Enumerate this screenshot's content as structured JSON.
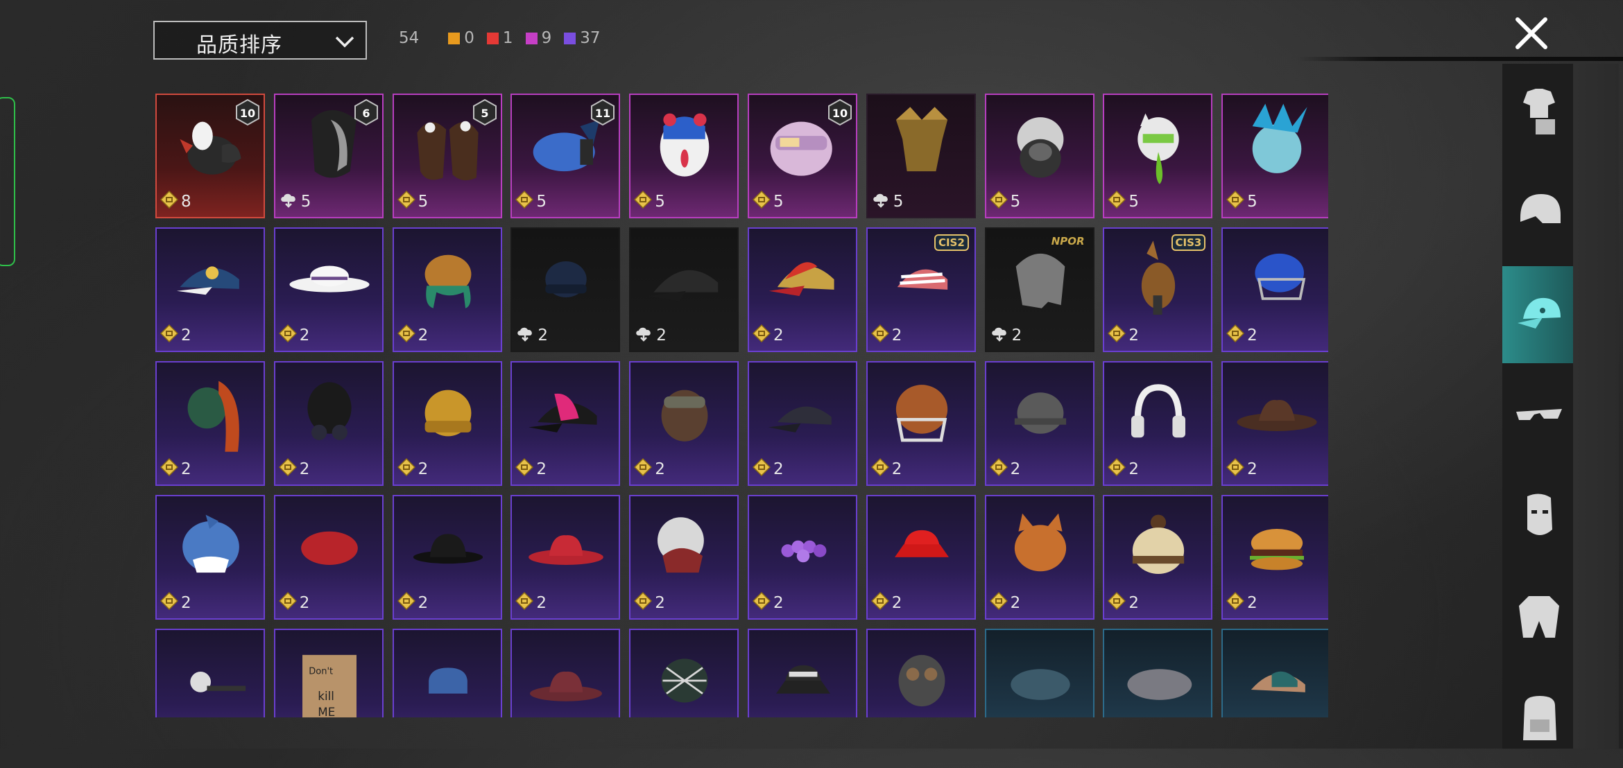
{
  "header": {
    "sort_label": "品质排序",
    "total_count": "54",
    "rarity_counts": [
      {
        "value": "0",
        "color": "#e89a1e"
      },
      {
        "value": "1",
        "color": "#e53935"
      },
      {
        "value": "9",
        "color": "#c63fc6"
      },
      {
        "value": "37",
        "color": "#7a4ee0"
      }
    ]
  },
  "icons": {
    "close": "close-icon",
    "sort": "chevron-down-icon",
    "currency": "gold-coin-icon",
    "cloud": "cloud-download-icon"
  },
  "items": [
    {
      "name": "rooster-chef-helmet",
      "cost": "8",
      "rarity": "mythic",
      "level": "10",
      "art": "rooster",
      "currency": "coin"
    },
    {
      "name": "masked-hood",
      "cost": "5",
      "rarity": "legend",
      "level": "6",
      "art": "mask",
      "currency": "cloud"
    },
    {
      "name": "bunny-hair",
      "cost": "5",
      "rarity": "legend",
      "level": "5",
      "art": "hair",
      "currency": "coin"
    },
    {
      "name": "blue-tech-cap",
      "cost": "5",
      "rarity": "legend",
      "level": "11",
      "art": "techcap",
      "currency": "coin"
    },
    {
      "name": "clown-mask",
      "cost": "5",
      "rarity": "legend",
      "art": "clown",
      "currency": "coin"
    },
    {
      "name": "pink-helmet",
      "cost": "5",
      "rarity": "legend",
      "level": "10",
      "art": "pinkhelmet",
      "currency": "coin"
    },
    {
      "name": "gold-crown",
      "cost": "5",
      "rarity": "legend dark",
      "art": "crown",
      "currency": "cloud"
    },
    {
      "name": "gas-mask-helmet",
      "cost": "5",
      "rarity": "legend",
      "art": "gasmask",
      "currency": "coin"
    },
    {
      "name": "neko-helmet",
      "cost": "5",
      "rarity": "legend",
      "art": "neko",
      "currency": "coin"
    },
    {
      "name": "feather-helmet",
      "cost": "5",
      "rarity": "legend",
      "art": "feather",
      "currency": "coin"
    },
    {
      "name": "patterned-cap",
      "cost": "2",
      "rarity": "epic",
      "art": "cap-blue",
      "currency": "coin"
    },
    {
      "name": "white-sun-hat",
      "cost": "2",
      "rarity": "epic",
      "art": "sunhat",
      "currency": "coin"
    },
    {
      "name": "orange-beanie-hair",
      "cost": "2",
      "rarity": "epic",
      "art": "beanie-orange",
      "currency": "coin"
    },
    {
      "name": "navy-beanie",
      "cost": "2",
      "rarity": "dark",
      "art": "beanie-navy",
      "currency": "cloud"
    },
    {
      "name": "black-cap",
      "cost": "2",
      "rarity": "dark",
      "art": "cap-black",
      "currency": "cloud"
    },
    {
      "name": "red-gold-cap",
      "cost": "2",
      "rarity": "epic",
      "art": "cap-red",
      "currency": "coin"
    },
    {
      "name": "striped-cap",
      "cost": "2",
      "rarity": "epic",
      "tag": "CIS2",
      "art": "cap-striped",
      "currency": "coin"
    },
    {
      "name": "gray-hair",
      "cost": "2",
      "rarity": "dark",
      "tag": "NPOR",
      "art": "grayhair",
      "currency": "cloud"
    },
    {
      "name": "wooden-horse-mask",
      "cost": "2",
      "rarity": "epic",
      "tag": "CIS3",
      "art": "horse",
      "currency": "coin"
    },
    {
      "name": "cricket-helmet",
      "cost": "2",
      "rarity": "epic",
      "art": "cricket",
      "currency": "coin"
    },
    {
      "name": "dragon-mask",
      "cost": "2",
      "rarity": "epic",
      "art": "dragon",
      "currency": "coin"
    },
    {
      "name": "black-gas-mask",
      "cost": "2",
      "rarity": "epic",
      "art": "blackgas",
      "currency": "coin"
    },
    {
      "name": "mustard-beanie",
      "cost": "2",
      "rarity": "epic",
      "art": "beanie-mustard",
      "currency": "coin"
    },
    {
      "name": "pink-black-cap",
      "cost": "2",
      "rarity": "epic",
      "art": "cap-pink",
      "currency": "coin"
    },
    {
      "name": "aviator-hat",
      "cost": "2",
      "rarity": "epic",
      "art": "aviator",
      "currency": "coin"
    },
    {
      "name": "dark-cap",
      "cost": "2",
      "rarity": "epic",
      "art": "cap-dark",
      "currency": "coin"
    },
    {
      "name": "football-helmet",
      "cost": "2",
      "rarity": "epic",
      "art": "football",
      "currency": "coin"
    },
    {
      "name": "gray-helmet",
      "cost": "2",
      "rarity": "epic",
      "art": "grayhelmet",
      "currency": "coin"
    },
    {
      "name": "cat-ear-headphones",
      "cost": "2",
      "rarity": "epic",
      "art": "headphones",
      "currency": "coin"
    },
    {
      "name": "cowboy-hat",
      "cost": "2",
      "rarity": "epic",
      "art": "cowboy",
      "currency": "coin"
    },
    {
      "name": "shark-hood",
      "cost": "2",
      "rarity": "epic",
      "art": "shark",
      "currency": "coin"
    },
    {
      "name": "red-beret",
      "cost": "2",
      "rarity": "epic",
      "art": "beret",
      "currency": "coin"
    },
    {
      "name": "black-bowler",
      "cost": "2",
      "rarity": "epic",
      "art": "bowler",
      "currency": "coin"
    },
    {
      "name": "red-fedora",
      "cost": "2",
      "rarity": "epic",
      "art": "fedora-red",
      "currency": "coin"
    },
    {
      "name": "white-shark-head",
      "cost": "2",
      "rarity": "epic",
      "art": "whiteshark",
      "currency": "coin"
    },
    {
      "name": "flower-crown",
      "cost": "2",
      "rarity": "epic",
      "art": "flowers",
      "currency": "coin"
    },
    {
      "name": "red-bucket-hat",
      "cost": "2",
      "rarity": "epic",
      "art": "bucket-red",
      "currency": "coin"
    },
    {
      "name": "cat-mask",
      "cost": "2",
      "rarity": "epic",
      "art": "cat",
      "currency": "coin"
    },
    {
      "name": "knit-pompom-hat",
      "cost": "2",
      "rarity": "epic",
      "art": "pompom",
      "currency": "coin"
    },
    {
      "name": "burger-hat",
      "cost": "2",
      "rarity": "epic",
      "art": "burger",
      "currency": "coin"
    },
    {
      "name": "head-mirror",
      "cost": "",
      "rarity": "epic",
      "art": "headmirror",
      "currency": "none"
    },
    {
      "name": "cardboard-box",
      "cost": "",
      "rarity": "epic",
      "art": "box",
      "currency": "none"
    },
    {
      "name": "blue-sailor-cap",
      "cost": "",
      "rarity": "epic",
      "art": "sailor",
      "currency": "none"
    },
    {
      "name": "maroon-fedora",
      "cost": "",
      "rarity": "epic",
      "art": "fedora-maroon",
      "currency": "none"
    },
    {
      "name": "net-bandana",
      "cost": "",
      "rarity": "epic",
      "art": "bandana",
      "currency": "none"
    },
    {
      "name": "black-bucket-hat",
      "cost": "",
      "rarity": "epic",
      "art": "bucket-black",
      "currency": "none"
    },
    {
      "name": "pilot-helmet",
      "cost": "",
      "rarity": "epic",
      "art": "pilot",
      "currency": "none"
    },
    {
      "name": "teal-beret",
      "cost": "",
      "rarity": "blue",
      "art": "beret-teal",
      "currency": "none"
    },
    {
      "name": "gray-flat-cap",
      "cost": "",
      "rarity": "blue",
      "art": "flatcap",
      "currency": "none"
    },
    {
      "name": "tan-cap",
      "cost": "",
      "rarity": "blue",
      "art": "cap-tan",
      "currency": "none"
    }
  ],
  "box_text": "Don't kill ME",
  "sidebar": [
    {
      "name": "outfit-icon"
    },
    {
      "name": "helmet-icon"
    },
    {
      "name": "cap-icon",
      "active": true
    },
    {
      "name": "glasses-icon"
    },
    {
      "name": "face-mask-icon"
    },
    {
      "name": "jacket-icon"
    },
    {
      "name": "backpack-icon"
    }
  ]
}
